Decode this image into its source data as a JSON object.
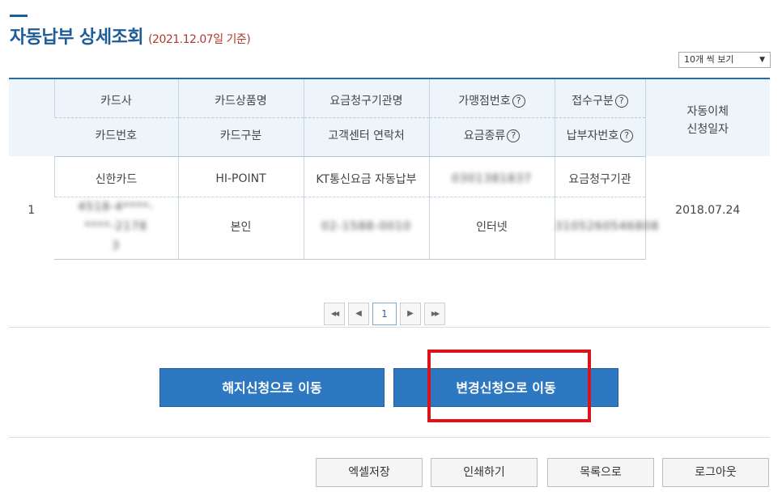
{
  "header": {
    "title": "자동납부 상세조회",
    "basis_date": "(2021.12.07일 기준)"
  },
  "page_size": {
    "label": "10개 씩 보기",
    "caret": "▼"
  },
  "table": {
    "headers_row1": [
      "카드사",
      "카드상품명",
      "요금청구기관명",
      "가맹점번호",
      "접수구분",
      "자동이체\n신청일자"
    ],
    "headers_row2": [
      "카드번호",
      "카드구분",
      "고객센터 연락처",
      "요금종류",
      "납부자번호"
    ],
    "help_glyph": "?",
    "row": {
      "no": "1",
      "card_company": "신한카드",
      "card_number": "4518-4****-****-2178\n3",
      "card_product": "HI-POINT",
      "card_type": "본인",
      "billing_org": "KT통신요금 자동납부",
      "contact": "02-1588-0010",
      "merchant_no": "0301381837",
      "fee_type": "인터넷",
      "reception": "요금청구기관",
      "payer_no": "3105260546808",
      "apply_date": "2018.07.24"
    }
  },
  "pagination": {
    "first": "◀◀",
    "prev": "◀",
    "current": "1",
    "next": "▶",
    "last": "▶▶"
  },
  "actions": {
    "cancel_apply": "해지신청으로 이동",
    "change_apply": "변경신청으로 이동"
  },
  "bottom_buttons": {
    "excel": "엑셀저장",
    "print": "인쇄하기",
    "list": "목록으로",
    "logout": "로그아웃"
  },
  "colors": {
    "title": "#1d5c96",
    "basis": "#b03a2e",
    "primary_button": "#2d78c0",
    "highlight": "#d9141c"
  }
}
